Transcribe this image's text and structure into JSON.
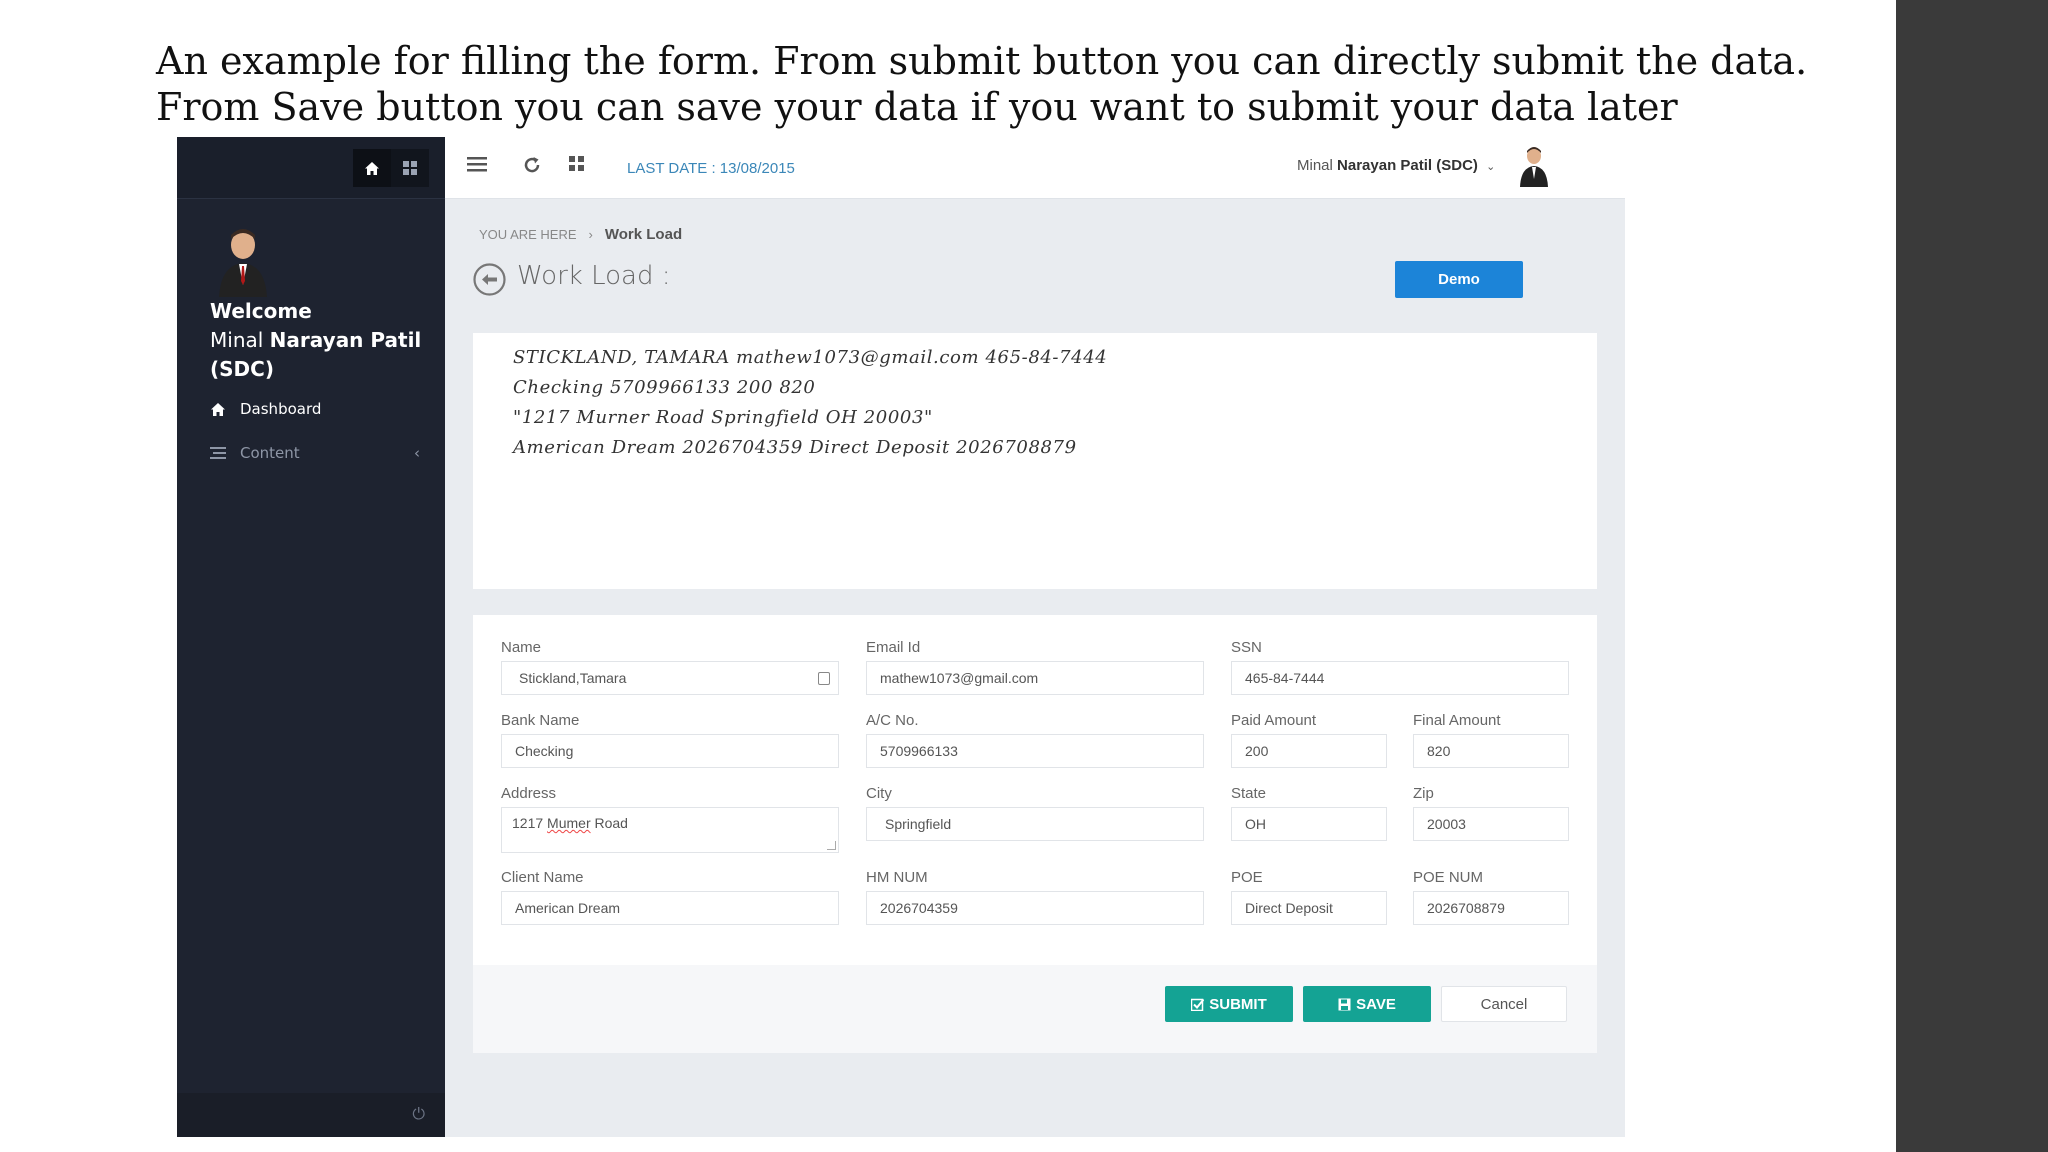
{
  "caption": {
    "line1": "An example for filling the form. From submit button you can directly submit the data.",
    "line2": "From Save button you can save your data if you want to submit your data later"
  },
  "sidebar": {
    "welcome": "Welcome",
    "user_first": "Minal",
    "user_rest": "Narayan Patil",
    "user_code": "(SDC)",
    "items": [
      {
        "label": "Dashboard",
        "icon": "home-icon"
      },
      {
        "label": "Content",
        "icon": "list-icon"
      }
    ]
  },
  "topbar": {
    "last_date": "LAST DATE : 13/08/2015",
    "user_first": "Minal",
    "user_rest": "Narayan Patil (SDC)"
  },
  "breadcrumb": {
    "prefix": "YOU ARE HERE",
    "current": "Work Load"
  },
  "page": {
    "title": "Work Load :",
    "demo_label": "Demo"
  },
  "handwriting": [
    "STICKLAND, TAMARA  mathew1073@gmail.com  465-84-7444",
    "Checking  5709966133  200  820",
    "\"1217 Murner Road Springfield OH 20003\"",
    "American Dream  2026704359  Direct Deposit  2026708879"
  ],
  "form": {
    "name": {
      "label": "Name",
      "value": "Stickland,Tamara"
    },
    "email": {
      "label": "Email Id",
      "value": "mathew1073@gmail.com"
    },
    "ssn": {
      "label": "SSN",
      "value": "465-84-7444"
    },
    "bank": {
      "label": "Bank Name",
      "value": "Checking"
    },
    "acno": {
      "label": "A/C No.",
      "value": "5709966133"
    },
    "paid": {
      "label": "Paid Amount",
      "value": "200"
    },
    "final": {
      "label": "Final Amount",
      "value": "820"
    },
    "address": {
      "label": "Address",
      "value_pre": "1217 ",
      "value_mark": "Mumer",
      "value_post": " Road"
    },
    "city": {
      "label": "City",
      "value": "Springfield"
    },
    "state": {
      "label": "State",
      "value": "OH"
    },
    "zip": {
      "label": "Zip",
      "value": "20003"
    },
    "client": {
      "label": "Client Name",
      "value": "American Dream"
    },
    "hmnum": {
      "label": "HM NUM",
      "value": "2026704359"
    },
    "poe": {
      "label": "POE",
      "value": "Direct Deposit"
    },
    "poenum": {
      "label": "POE NUM",
      "value": "2026708879"
    }
  },
  "actions": {
    "submit": "SUBMIT",
    "save": "SAVE",
    "cancel": "Cancel"
  },
  "colors": {
    "sidebar_bg": "#1e2330",
    "accent_blue": "#1c84d8",
    "accent_teal": "#14a394",
    "link_blue": "#3b87b8"
  }
}
